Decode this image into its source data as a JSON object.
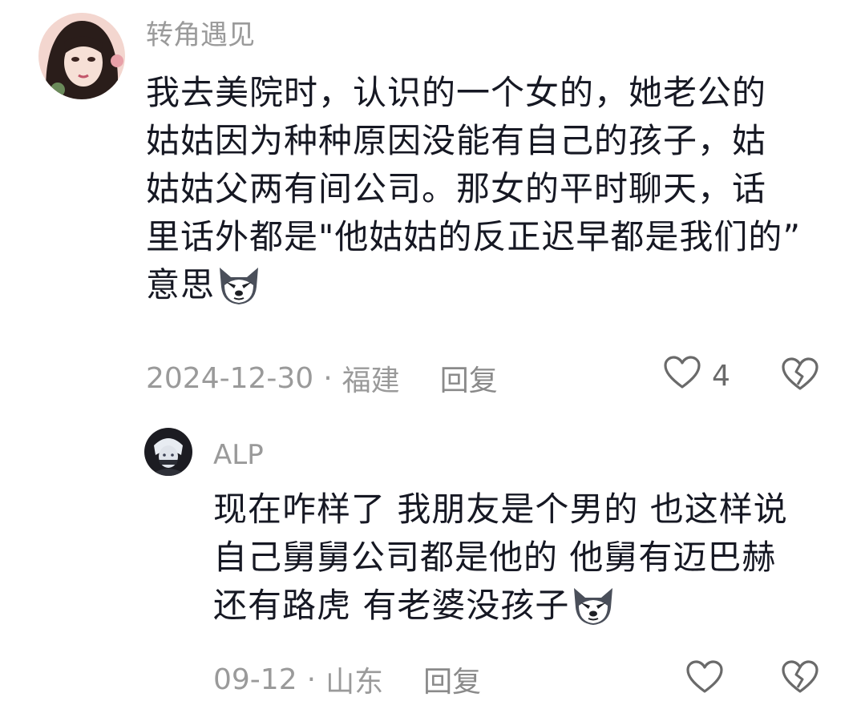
{
  "comment": {
    "username": "转角遇见",
    "lines": [
      "我去美院时，认识的一个女的，她老公的",
      "姑姑因为种种原因没能有自己的孩子，姑",
      "姑姑父两有间公司。那女的平时聊天，话",
      "里话外都是\"他姑姑的反正迟早都是我们的”",
      "意思"
    ],
    "emoji_icon": "wolf-face-emoji",
    "date": "2024-12-30",
    "separator": "·",
    "location": "福建",
    "reply_label": "回复",
    "like_count": "4",
    "like_icon": "heart-outline-icon",
    "dislike_icon": "broken-heart-icon"
  },
  "reply": {
    "username": "ALP",
    "lines": [
      "现在咋样了 我朋友是个男的 也这样说",
      "自己舅舅公司都是他的 他舅有迈巴赫",
      "还有路虎 有老婆没孩子"
    ],
    "emoji_icon": "wolf-face-emoji",
    "date": "09-12",
    "separator": "·",
    "location": "山东",
    "reply_label": "回复",
    "like_icon": "heart-outline-icon",
    "dislike_icon": "broken-heart-icon"
  },
  "colors": {
    "username": "#9a9a9a",
    "text": "#161823",
    "meta": "#9a9a9a"
  }
}
